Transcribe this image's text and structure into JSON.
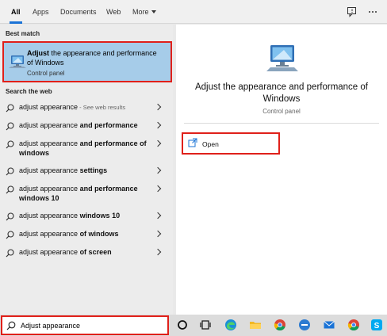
{
  "tabs": [
    {
      "label": "All",
      "active": true
    },
    {
      "label": "Apps"
    },
    {
      "label": "Documents"
    },
    {
      "label": "Web"
    },
    {
      "label": "More"
    }
  ],
  "top_icons": [
    "feedback-icon",
    "more-options-icon"
  ],
  "best_match": {
    "section_label": "Best match",
    "title_bold": "Adjust",
    "title_rest": " the appearance and performance of Windows",
    "subtitle": "Control panel",
    "icon": "computer-monitor-icon"
  },
  "web": {
    "section_label": "Search the web",
    "items": [
      {
        "plain": "adjust appearance",
        "bold": "",
        "hint": " - See web results"
      },
      {
        "plain": "adjust appearance ",
        "bold": "and performance",
        "hint": ""
      },
      {
        "plain": "adjust appearance ",
        "bold": "and performance of windows",
        "hint": ""
      },
      {
        "plain": "adjust appearance ",
        "bold": "settings",
        "hint": ""
      },
      {
        "plain": "adjust appearance ",
        "bold": "and performance windows 10",
        "hint": ""
      },
      {
        "plain": "adjust appearance ",
        "bold": "windows 10",
        "hint": ""
      },
      {
        "plain": "adjust appearance ",
        "bold": "of windows",
        "hint": ""
      },
      {
        "plain": "adjust appearance ",
        "bold": "of screen",
        "hint": ""
      }
    ]
  },
  "detail": {
    "title": "Adjust the appearance and performance of Windows",
    "subtitle": "Control panel",
    "actions": [
      {
        "label": "Open",
        "icon": "open-icon"
      }
    ]
  },
  "search": {
    "value": "Adjust appearance",
    "icon": "search-icon"
  },
  "taskbar_icons": [
    "cortana-icon",
    "task-view-icon",
    "edge-icon",
    "file-explorer-icon",
    "chrome-icon",
    "remote-desktop-icon",
    "mail-icon",
    "chrome-icon",
    "skype-icon"
  ],
  "colors": {
    "accent": "#1a73d6",
    "highlight": "#a6cce9",
    "annotation_red": "#e0201a"
  }
}
